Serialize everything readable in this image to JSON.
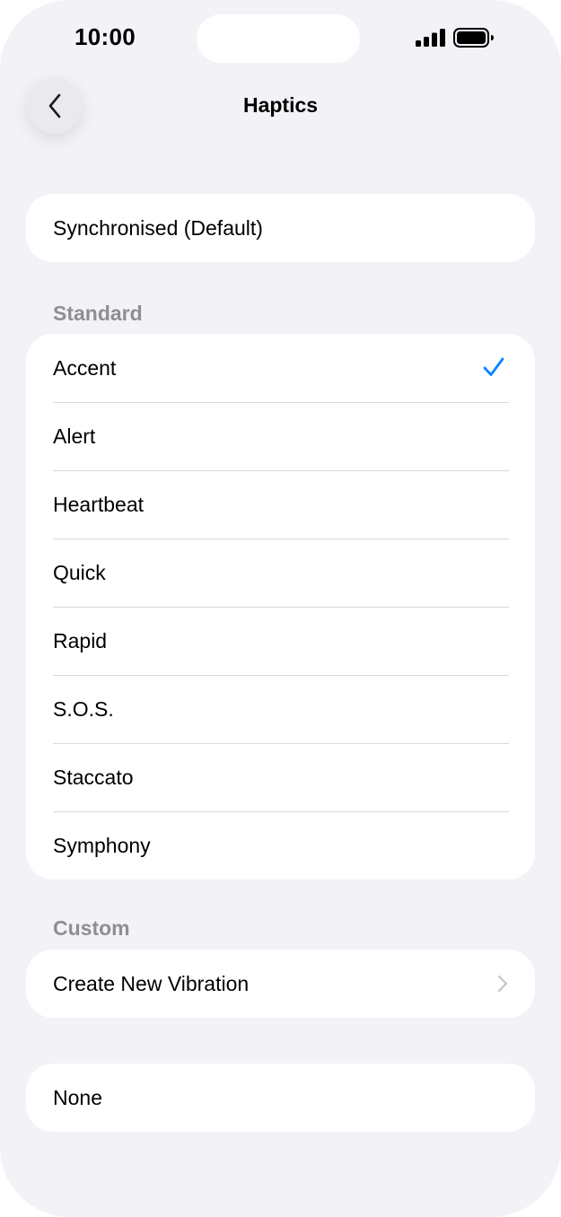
{
  "status_bar": {
    "time": "10:00",
    "signal_icon": "cellular-signal-icon",
    "battery_icon": "battery-full-icon"
  },
  "nav": {
    "back_icon": "chevron-left-icon",
    "title": "Haptics"
  },
  "default_option": {
    "label": "Synchronised (Default)"
  },
  "standard": {
    "header": "Standard",
    "selected": "Accent",
    "items": [
      {
        "label": "Accent",
        "checked": true
      },
      {
        "label": "Alert",
        "checked": false
      },
      {
        "label": "Heartbeat",
        "checked": false
      },
      {
        "label": "Quick",
        "checked": false
      },
      {
        "label": "Rapid",
        "checked": false
      },
      {
        "label": "S.O.S.",
        "checked": false
      },
      {
        "label": "Staccato",
        "checked": false
      },
      {
        "label": "Symphony",
        "checked": false
      }
    ]
  },
  "custom": {
    "header": "Custom",
    "create_label": "Create New Vibration"
  },
  "none_option": {
    "label": "None"
  },
  "colors": {
    "accent": "#0a84ff",
    "background": "#f2f2f7",
    "secondary_text": "#8e8e93",
    "chevron": "#c4c4c7"
  }
}
